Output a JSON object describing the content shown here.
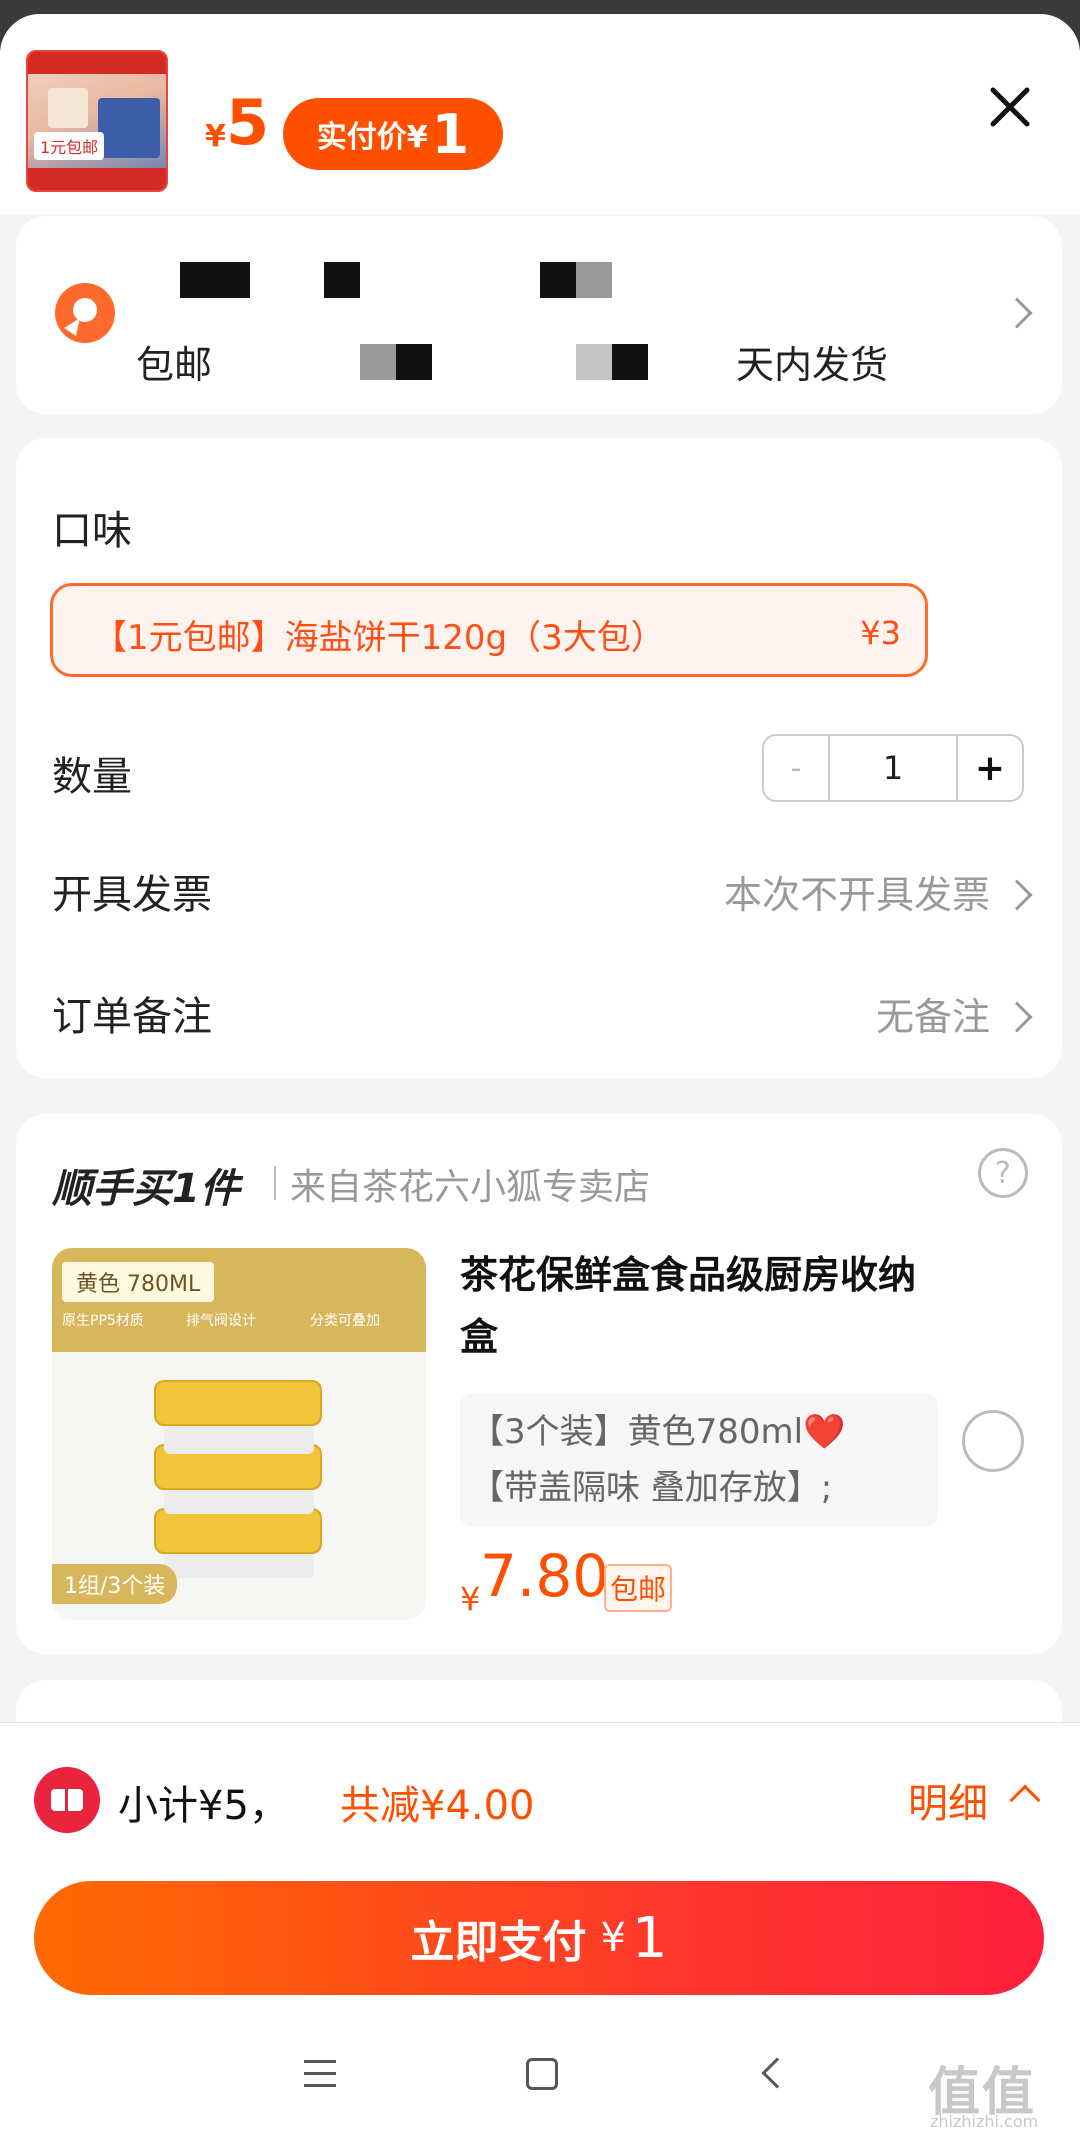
{
  "header": {
    "price_yen": "¥",
    "price_value": "5",
    "paid_label": "实付价¥",
    "paid_value": "1",
    "thumb_badge": "1元包邮"
  },
  "address": {
    "line2_start": "包邮",
    "line2_end": "天内发货"
  },
  "options": {
    "flavor_label": "口味",
    "flavor_name": "【1元包邮】海盐饼干120g（3大包）",
    "flavor_price": "¥3",
    "quantity_label": "数量",
    "quantity_minus": "-",
    "quantity_value": "1",
    "quantity_plus": "+",
    "invoice_label": "开具发票",
    "invoice_value": "本次不开具发票",
    "note_label": "订单备注",
    "note_value": "无备注"
  },
  "addon": {
    "title": "顺手买1件",
    "store": "来自茶花六小狐专卖店",
    "help": "?",
    "image_tag": "黄色 780ML",
    "image_feat_1": "原生PP5材质",
    "image_feat_2": "排气阀设计",
    "image_feat_3": "分类可叠加",
    "image_count": "1组/3个装",
    "name": "茶花保鲜盒食品级厨房收纳盒",
    "spec_line1": "【3个装】黄色780ml❤️",
    "spec_line2": "【带盖隔味 叠加存放】;",
    "price_yen": "¥",
    "price": "7.80",
    "free_shipping": "包邮"
  },
  "footer": {
    "subtotal": "小计¥5，",
    "savings": "共减¥4.00",
    "detail": "明细",
    "pay_label": "立即支付",
    "pay_yen": "¥",
    "pay_amount": "1"
  },
  "watermark": {
    "text": "值值值",
    "sub": "zhizhizhi.com"
  },
  "colors": {
    "accent": "#ff5000",
    "pay_gradient_start": "#ff6a00",
    "pay_gradient_end": "#ff1f3d"
  }
}
